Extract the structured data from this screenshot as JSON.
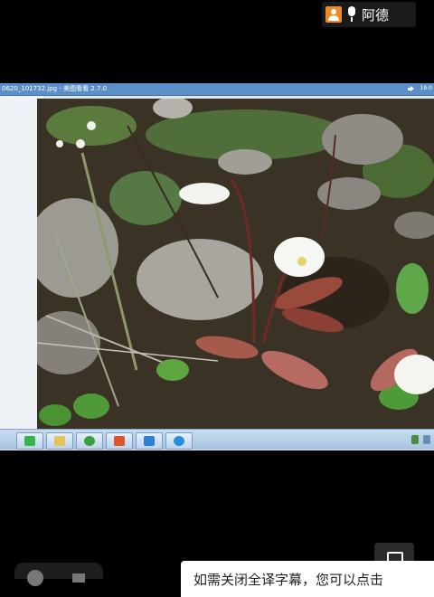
{
  "stream_user": {
    "name": "阿德",
    "avatar_color": "#f08a24"
  },
  "viewer": {
    "title": "0620_101732.jpg - 美图看看 2.7.0",
    "clock": "19:0",
    "titlebar_color": "#5c8fc7"
  },
  "taskbar": {
    "items": [
      {
        "icon": "wechat-icon",
        "color": "#35b44a"
      },
      {
        "icon": "folder-icon",
        "color": "#e6c35a"
      },
      {
        "icon": "browser-icon",
        "color": "#3aa03c"
      },
      {
        "icon": "presentation-icon",
        "color": "#d9552b"
      },
      {
        "icon": "photo-viewer-icon",
        "color": "#2e7fd6"
      },
      {
        "icon": "globe-icon",
        "color": "#2a8fd8"
      }
    ]
  },
  "caption": {
    "text": "如需关闭全译字幕，您可以点击"
  }
}
